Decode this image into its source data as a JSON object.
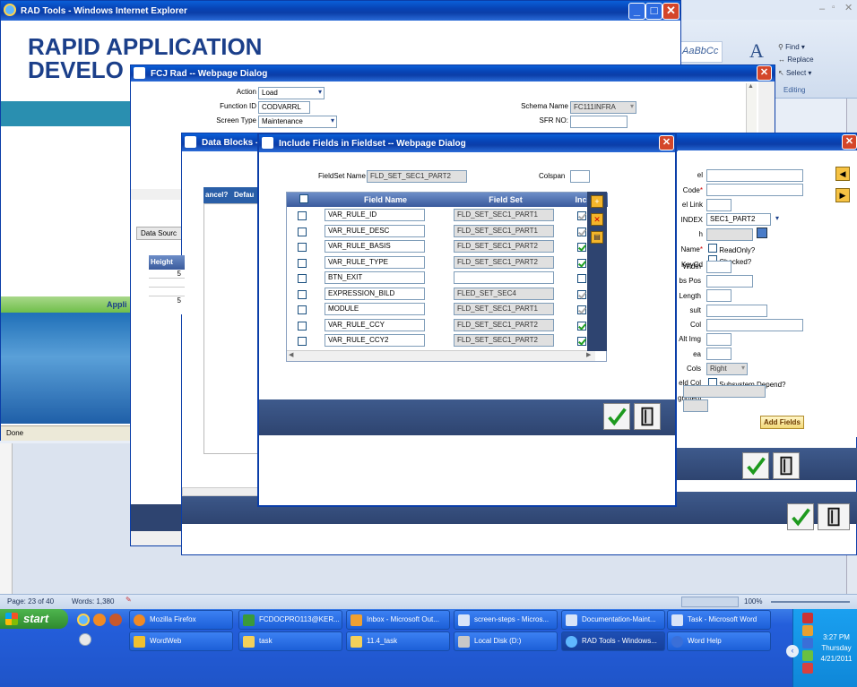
{
  "ie_window": {
    "title": "RAD Tools - Windows Internet Explorer",
    "banner_line1": "RAPID APPLICATION",
    "banner_line2": "DEVELO",
    "status": "Done",
    "side_text": "Appli"
  },
  "word": {
    "ribbon": {
      "find": "Find",
      "replace": "Replace",
      "select": "Select",
      "group": "Editing",
      "style": "AaBbCc"
    },
    "status": {
      "page": "Page: 23 of 40",
      "words": "Words: 1,380",
      "zoom": "100%"
    }
  },
  "fcj_dialog": {
    "title": "FCJ Rad -- Webpage Dialog",
    "fields": {
      "action_label": "Action",
      "action_value": "Load",
      "function_label": "Function ID",
      "function_value": "CODVARRL",
      "screen_label": "Screen Type",
      "screen_value": "Maintenance",
      "schema_label": "Schema Name",
      "schema_value": "FC111INFRA",
      "sfr_label": "SFR NO:"
    },
    "data_source_tab": "Data Sourc"
  },
  "data_blocks": {
    "title": "Data Blocks --",
    "col_cancel": "ancel?",
    "col_default": "Defau",
    "height_header": "Height",
    "height_values": [
      "5",
      "5"
    ]
  },
  "right_panel": {
    "labels": [
      "el Code",
      "el Link",
      "INDEX",
      "h Name",
      "KeyCd",
      "Width",
      "bs Pos",
      "Length",
      "sult Col",
      "Alt Img",
      "ea Cols",
      "eld Col",
      "gnment"
    ],
    "name_value": "SEC1_PART2",
    "readonly": "ReadOnly?",
    "checked": "Checked?",
    "alignment_value": "Right",
    "subsystem": "Subsystem Depend?",
    "add_fields": "Add Fields"
  },
  "include_dialog": {
    "title": "Include Fields in Fieldset -- Webpage Dialog",
    "fieldset_label": "FieldSet Name",
    "fieldset_value": "FLD_SET_SEC1_PART2",
    "colspan_label": "Colspan",
    "columns": [
      "Field Name",
      "Field Set",
      "Inclu"
    ],
    "rows": [
      {
        "name": "VAR_RULE_ID",
        "set": "FLD_SET_SEC1_PART1",
        "incl": "gray"
      },
      {
        "name": "VAR_RULE_DESC",
        "set": "FLD_SET_SEC1_PART1",
        "incl": "gray"
      },
      {
        "name": "VAR_RULE_BASIS",
        "set": "FLD_SET_SEC1_PART2",
        "incl": "green"
      },
      {
        "name": "VAR_RULE_TYPE",
        "set": "FLD_SET_SEC1_PART2",
        "incl": "green"
      },
      {
        "name": "BTN_EXIT",
        "set": "",
        "incl": "empty"
      },
      {
        "name": "EXPRESSION_BILD",
        "set": "FLED_SET_SEC4",
        "incl": "gray"
      },
      {
        "name": "MODULE",
        "set": "FLD_SET_SEC1_PART1",
        "incl": "gray"
      },
      {
        "name": "VAR_RULE_CCY",
        "set": "FLD_SET_SEC1_PART2",
        "incl": "green"
      },
      {
        "name": "VAR_RULE_CCY2",
        "set": "FLD_SET_SEC1_PART2",
        "incl": "green"
      }
    ]
  },
  "taskbar": {
    "start": "start",
    "row1": [
      "Mozilla Firefox",
      "FCDOCPRO113@KER...",
      "Inbox - Microsoft Out...",
      "screen-steps - Micros...",
      "Documentation-Maint...",
      "Task - Microsoft Word"
    ],
    "row2": [
      "WordWeb",
      "task",
      "11.4_task",
      "Local Disk (D:)",
      "RAD Tools - Windows...",
      "Word Help"
    ],
    "clock_time": "3:27 PM",
    "clock_day": "Thursday",
    "clock_date": "4/21/2011"
  },
  "colors": {
    "xp_blue": "#0843b4",
    "close_red": "#d4462a",
    "taskbar": "#245edb",
    "accent_teal": "#2a8fb0"
  }
}
